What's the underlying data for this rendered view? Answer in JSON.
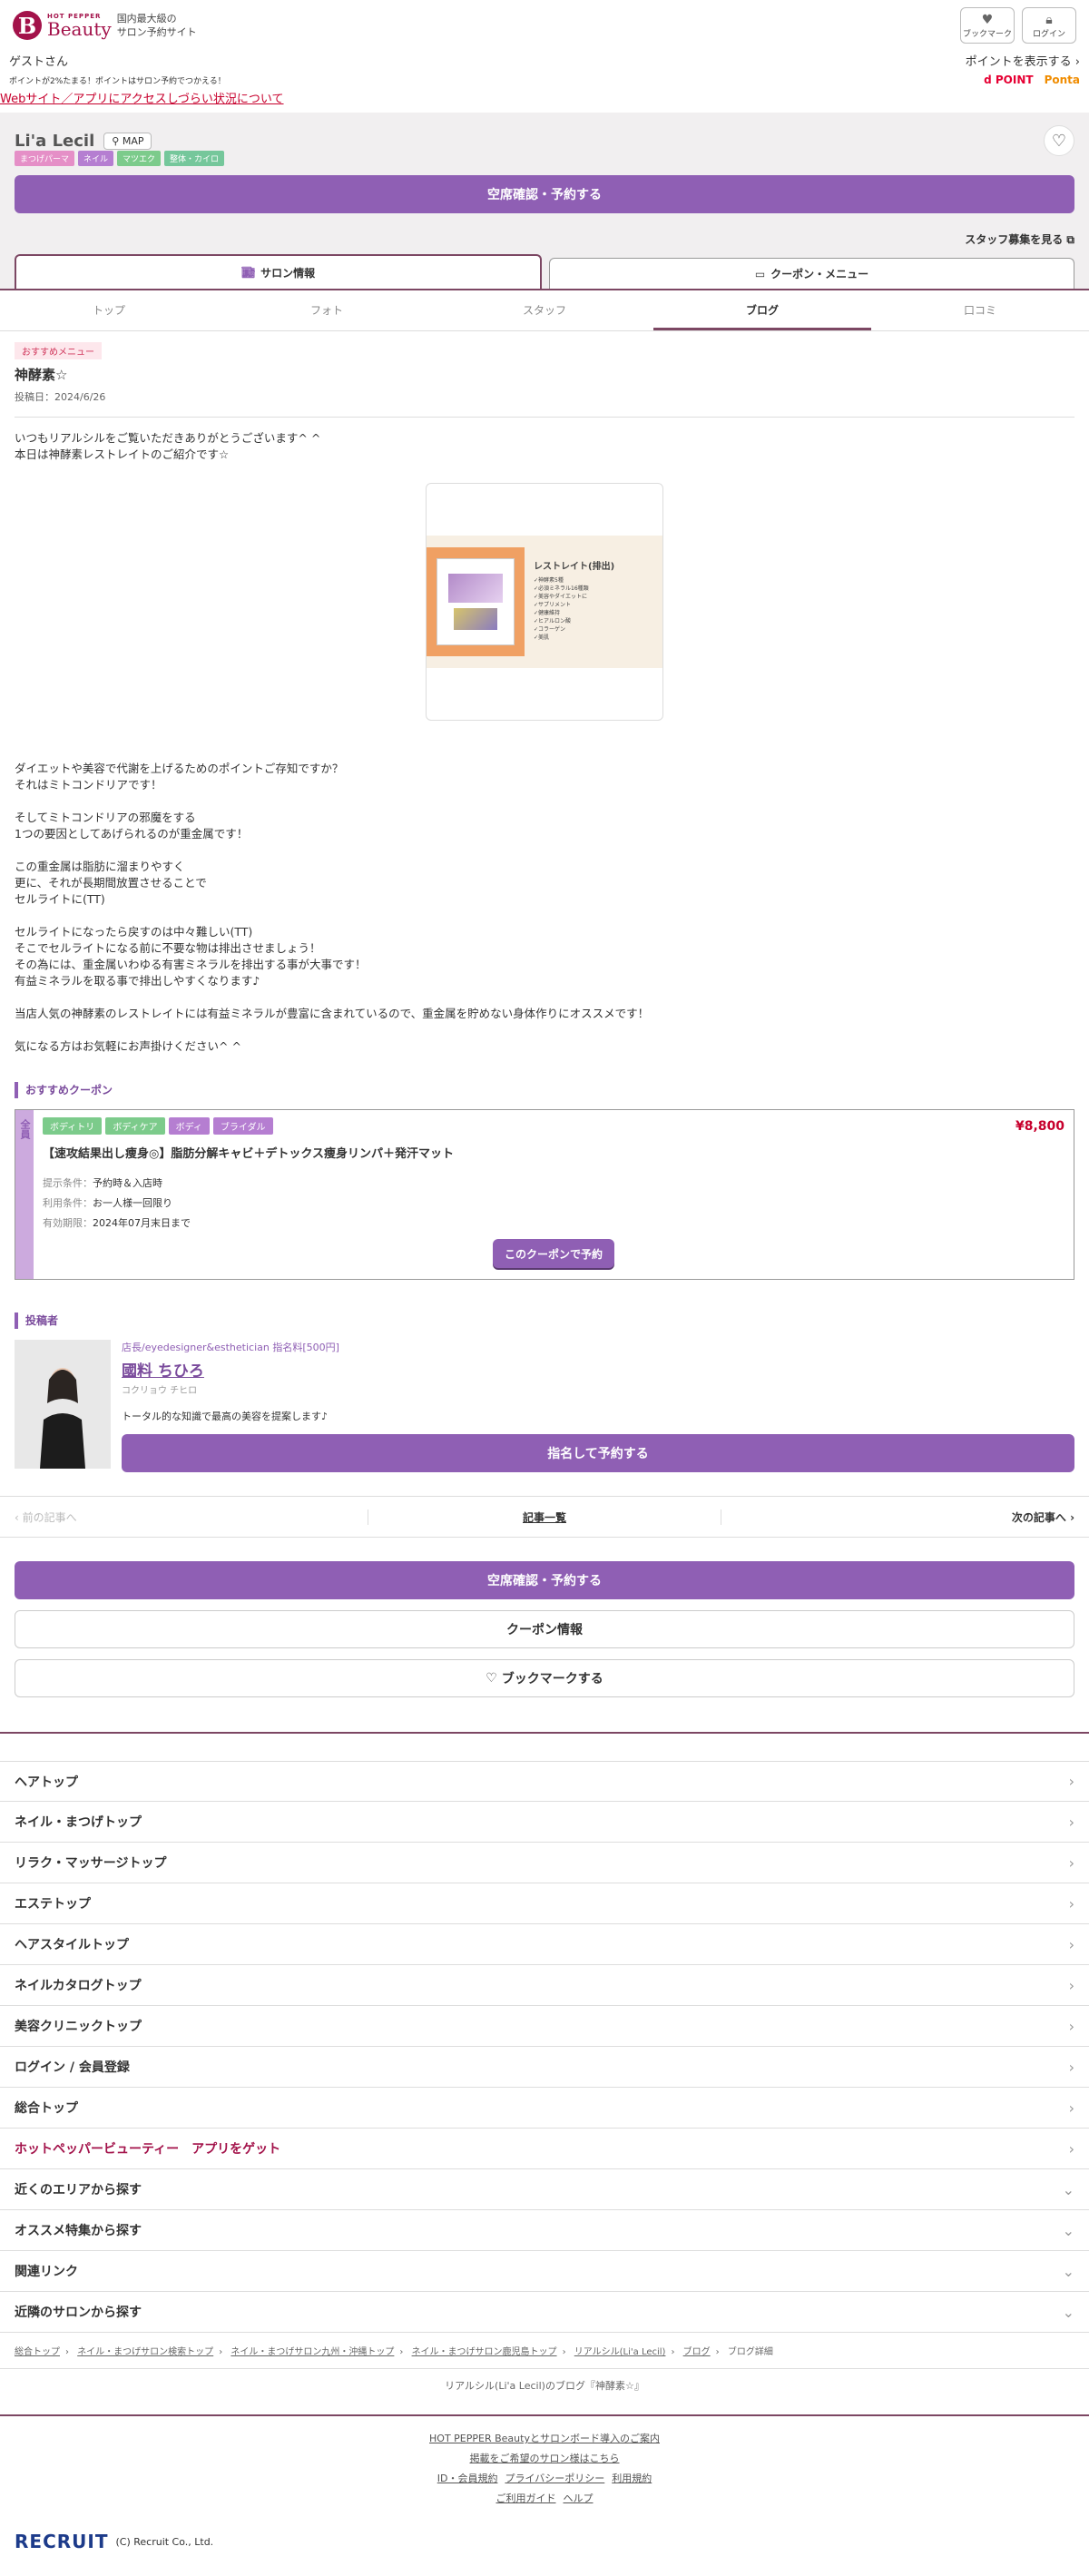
{
  "header": {
    "logo_small": "HOT PEPPER",
    "logo_big": "Beauty",
    "logo_letter": "B",
    "tagline_1": "国内最大級の",
    "tagline_2": "サロン予約サイト",
    "bookmark_label": "ブックマーク",
    "login_label": "ログイン"
  },
  "user": {
    "greeting": "ゲストさん",
    "show_points": "ポイントを表示する",
    "points_note": "ポイントが2%たまる！ポイントはサロン予約でつかえる！",
    "dpoint_label": "d POINT",
    "ponta_label": "Ponta",
    "access_notice": "Webサイト／アプリにアクセスしづらい状況について"
  },
  "salon": {
    "name": "Li'a Lecil",
    "map_label": "MAP",
    "tags": [
      {
        "label": "まつげパーマ",
        "color": "#e58fc7"
      },
      {
        "label": "ネイル",
        "color": "#b57ed1"
      },
      {
        "label": "マツエク",
        "color": "#7ccb8b"
      },
      {
        "label": "整体・カイロ",
        "color": "#75c79b"
      }
    ],
    "reserve_label": "空席確認・予約する",
    "staff_recruit": "スタッフ募集を見る"
  },
  "main_tabs": {
    "salon_info": "サロン情報",
    "coupon_menu": "クーポン・メニュー"
  },
  "sub_tabs": [
    "トップ",
    "フォト",
    "スタッフ",
    "ブログ",
    "口コミ"
  ],
  "blog": {
    "category": "おすすめメニュー",
    "title": "神酵素☆",
    "date": "投稿日：2024/6/26",
    "intro": "いつもリアルシルをご覧いただきありがとうございます^ ^\n本日は神酵素レストレイトのご紹介です☆",
    "image_title": "レストレイト(排出)",
    "image_lines": [
      "✓神酵素5種",
      "✓必須ミネラル16種類",
      "✓美容やダイエットに",
      "✓サプリメント",
      "✓健康維持",
      "✓ヒアルロン酸",
      "✓コラーゲン",
      "✓美肌"
    ],
    "body": "ダイエットや美容で代謝を上げるためのポイントご存知ですか？\nそれはミトコンドリアです！\n\nそしてミトコンドリアの邪魔をする\n1つの要因としてあげられるのが重金属です！\n\nこの重金属は脂肪に溜まりやすく\n更に、それが長期間放置させることで\nセルライトに(TT)\n\nセルライトになったら戻すのは中々難しい(TT)\nそこでセルライトになる前に不要な物は排出させましょう！\nその為には、重金属いわゆる有害ミネラルを排出する事が大事です！\n有益ミネラルを取る事で排出しやすくなります♪\n\n当店人気の神酵素のレストレイトには有益ミネラルが豊富に含まれているので、重金属を貯めない身体作りにオススメです！\n\n気になる方はお気軽にお声掛けください^ ^"
  },
  "coupon_section": {
    "label": "おすすめクーポン",
    "side_label": "全員",
    "tags": [
      {
        "label": "ボディトリ",
        "color": "#7ccb8b"
      },
      {
        "label": "ボディケア",
        "color": "#7ccb8b"
      },
      {
        "label": "ボディ",
        "color": "#b57ed1"
      },
      {
        "label": "ブライダル",
        "color": "#b57ed1"
      }
    ],
    "price": "¥8,800",
    "title": "【速攻結果出し痩身◎】脂肪分解キャビ＋デトックス痩身リンパ＋発汗マット",
    "conditions": [
      {
        "k": "提示条件：",
        "v": "予約時＆入店時"
      },
      {
        "k": "利用条件：",
        "v": "お一人様一回限り"
      },
      {
        "k": "有効期限：",
        "v": "2024年07月末日まで"
      }
    ],
    "button": "このクーポンで予約"
  },
  "author_section": {
    "label": "投稿者",
    "role": "店長/eyedesigner&esthetician 指名料[500円]",
    "name": "國料 ちひろ",
    "kana": "コクリョウ チヒロ",
    "desc": "トータル的な知識で最高の美容を提案します♪",
    "button": "指名して予約する"
  },
  "pager": {
    "prev": "前の記事へ",
    "list": "記事一覧",
    "next": "次の記事へ"
  },
  "actions": {
    "reserve": "空席確認・予約する",
    "coupon_info": "クーポン情報",
    "bookmark": "ブックマークする"
  },
  "nav_items": [
    {
      "label": "ヘアトップ",
      "chev": "›",
      "red": false
    },
    {
      "label": "ネイル・まつげトップ",
      "chev": "›",
      "red": false
    },
    {
      "label": "リラク・マッサージトップ",
      "chev": "›",
      "red": false
    },
    {
      "label": "エステトップ",
      "chev": "›",
      "red": false
    },
    {
      "label": "ヘアスタイルトップ",
      "chev": "›",
      "red": false
    },
    {
      "label": "ネイルカタログトップ",
      "chev": "›",
      "red": false
    },
    {
      "label": "美容クリニックトップ",
      "chev": "›",
      "red": false
    },
    {
      "label": "ログイン / 会員登録",
      "chev": "›",
      "red": false
    },
    {
      "label": "総合トップ",
      "chev": "›",
      "red": false
    },
    {
      "label": "ホットペッパービューティー　アプリをゲット",
      "chev": "›",
      "red": true
    },
    {
      "label": "近くのエリアから探す",
      "chev": "⌄",
      "red": false
    },
    {
      "label": "オススメ特集から探す",
      "chev": "⌄",
      "red": false
    },
    {
      "label": "関連リンク",
      "chev": "⌄",
      "red": false
    },
    {
      "label": "近隣のサロンから探す",
      "chev": "⌄",
      "red": false
    }
  ],
  "breadcrumb": [
    "総合トップ",
    "ネイル・まつげサロン検索トップ",
    "ネイル・まつげサロン九州・沖縄トップ",
    "ネイル・まつげサロン鹿児島トップ",
    "リアルシル(Li'a Lecil)",
    "ブログ",
    "ブログ詳細"
  ],
  "blog_caption": "リアルシル(Li'a Lecil)のブログ『神酵素☆』",
  "footer": {
    "link1": "HOT PEPPER Beautyとサロンボード導入のご案内",
    "link2": "掲載をご希望のサロン様はこちら",
    "link3a": "ID・会員規約",
    "link3b": "プライバシーポリシー",
    "link3c": "利用規約",
    "link4a": "ご利用ガイド",
    "link4b": "ヘルプ",
    "company": "RECRUIT",
    "copyright": "(C) Recruit Co., Ltd."
  }
}
